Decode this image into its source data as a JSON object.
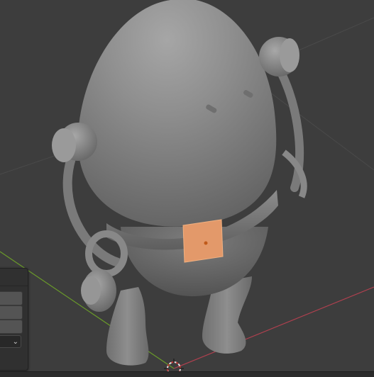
{
  "viewport": {
    "background": "#3d3d3d",
    "model_color": "#8a8a8a",
    "selected_face_color": "#e3996a",
    "x_axis_color": "#b0404f",
    "y_axis_color": "#6a9a2a"
  },
  "operator_panel": {
    "dropdown_icon": "chevron-down-icon",
    "dropdown_glyph": "⌄"
  },
  "cursor": {
    "icon": "3d-cursor-icon"
  }
}
